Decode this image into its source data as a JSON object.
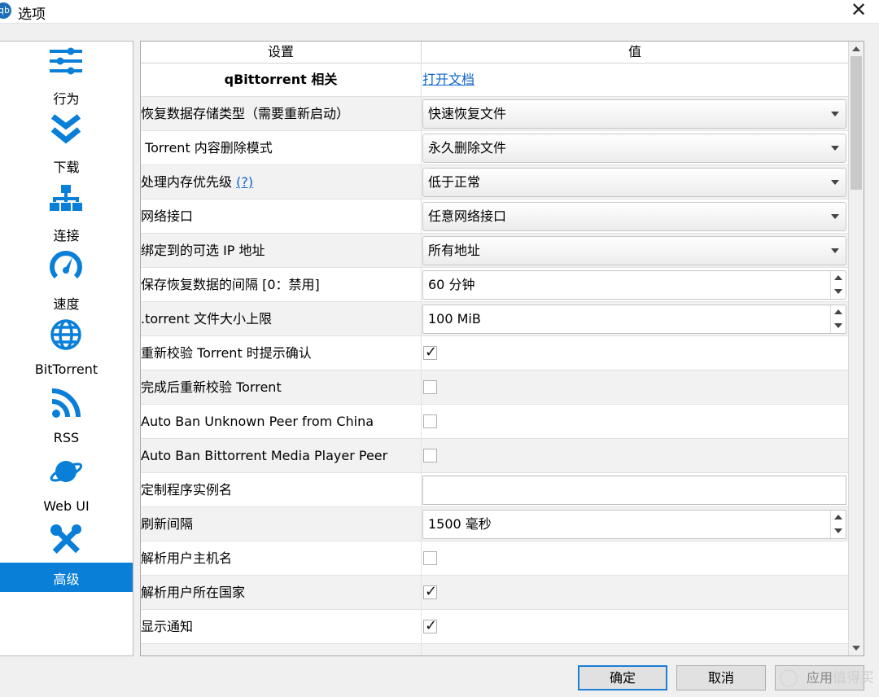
{
  "window": {
    "title": "选项",
    "app_icon": "qb"
  },
  "sidebar": {
    "items": [
      {
        "label": "行为",
        "icon": "sliders-icon"
      },
      {
        "label": "下载",
        "icon": "download-chevron-icon"
      },
      {
        "label": "连接",
        "icon": "network-icon"
      },
      {
        "label": "速度",
        "icon": "speedometer-icon"
      },
      {
        "label": "BitTorrent",
        "icon": "globe-icon"
      },
      {
        "label": "RSS",
        "icon": "rss-icon"
      },
      {
        "label": "Web UI",
        "icon": "planet-icon"
      },
      {
        "label": "高级",
        "icon": "tools-icon",
        "active": true
      }
    ]
  },
  "table": {
    "headers": {
      "setting": "设置",
      "value": "值"
    },
    "section": {
      "label": "qBittorrent 相关",
      "link": "打开文档"
    },
    "rows": [
      {
        "label": "恢复数据存储类型（需要重新启动）",
        "type": "combo",
        "value": "快速恢复文件"
      },
      {
        "label": " Torrent 内容删除模式",
        "type": "combo",
        "value": "永久删除文件"
      },
      {
        "label": "处理内存优先级",
        "help": "(?)",
        "type": "combo",
        "value": "低于正常"
      },
      {
        "label": "网络接口",
        "type": "combo",
        "value": "任意网络接口"
      },
      {
        "label": "绑定到的可选 IP 地址",
        "type": "combo",
        "value": "所有地址"
      },
      {
        "label": "保存恢复数据的间隔 [0：禁用]",
        "type": "spin",
        "value": "60 分钟"
      },
      {
        "label": ".torrent 文件大小上限",
        "type": "spin",
        "value": "100 MiB"
      },
      {
        "label": "重新校验 Torrent 时提示确认",
        "type": "check",
        "checked": true
      },
      {
        "label": "完成后重新校验 Torrent",
        "type": "check",
        "checked": false
      },
      {
        "label": "Auto Ban Unknown Peer from China",
        "type": "check",
        "checked": false
      },
      {
        "label": "Auto Ban Bittorrent Media Player Peer",
        "type": "check",
        "checked": false
      },
      {
        "label": "定制程序实例名",
        "type": "text",
        "value": ""
      },
      {
        "label": "刷新间隔",
        "type": "spin",
        "value": "1500 毫秒"
      },
      {
        "label": "解析用户主机名",
        "type": "check",
        "checked": false
      },
      {
        "label": "解析用户所在国家",
        "type": "check",
        "checked": true
      },
      {
        "label": "显示通知",
        "type": "check",
        "checked": true
      }
    ]
  },
  "buttons": {
    "ok": "确定",
    "cancel": "取消",
    "apply": "应用"
  },
  "watermark": "值得买",
  "colors": {
    "accent": "#0a7fd8",
    "link": "#0d65c9"
  }
}
